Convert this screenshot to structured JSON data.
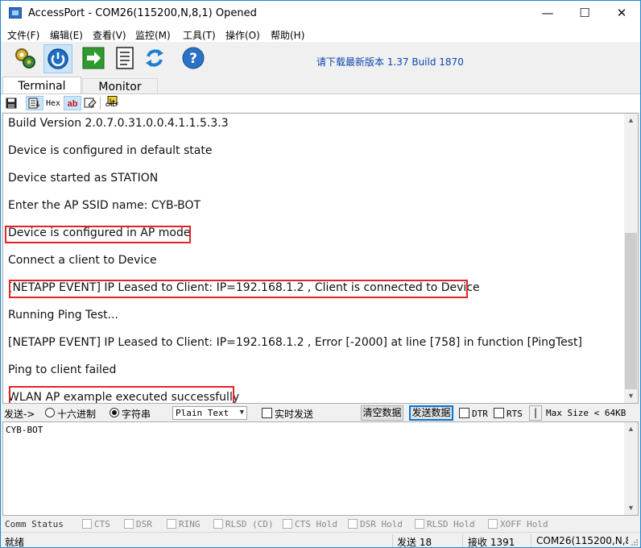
{
  "window": {
    "title": "AccessPort - COM26(115200,N,8,1) Opened",
    "minimize": "—",
    "maximize": "☐",
    "close": "✕"
  },
  "menu": [
    "文件(F)",
    "编辑(E)",
    "查看(V)",
    "监控(M)",
    "工具(T)",
    "操作(O)",
    "帮助(H)"
  ],
  "toolbar": {
    "buttons": [
      "settings-gears",
      "power",
      "go-arrow",
      "document",
      "refresh",
      "help"
    ],
    "promo": "请下载最新版本 1.37 Build 1870"
  },
  "tabs": [
    "Terminal",
    "Monitor"
  ],
  "small_tools": {
    "hex": "Hex",
    "ab": "ab",
    "crlf": "CRLF"
  },
  "terminal": {
    "lines": [
      "Build Version 2.0.7.0.31.0.0.4.1.1.5.3.3",
      "Device is configured in default state",
      "Device started as STATION",
      "Enter the AP SSID name: CYB-BOT",
      "Device is configured in AP mode",
      "Connect a client to Device",
      "[NETAPP EVENT] IP Leased to Client: IP=192.168.1.2 , Client is connected to Device",
      "Running Ping Test...",
      "[NETAPP EVENT] IP Leased to Client: IP=192.168.1.2 , Error [-2000] at line [758] in function [PingTest]",
      "Ping to client failed",
      "WLAN AP example executed successfully"
    ]
  },
  "send_row": {
    "send_label": "发送->",
    "hex_option": "十六进制",
    "string_option": "字符串",
    "selected_format": "Plain Text",
    "realtime_send": "实时发送",
    "clear_button": "清空数据",
    "send_button": "发送数据",
    "dtr": "DTR",
    "rts": "RTS",
    "pipe": "|",
    "max_size": "Max Size < 64KB"
  },
  "send_box": {
    "value": "CYB-BOT"
  },
  "comm_status": {
    "label": "Comm Status",
    "items": [
      "CTS",
      "DSR",
      "RING",
      "RLSD (CD)",
      "CTS Hold",
      "DSR Hold",
      "RLSD Hold",
      "XOFF Hold"
    ]
  },
  "status_bar": {
    "state": "就绪",
    "sent": "发送 18",
    "received": "接收 1391",
    "port": "COM26(115200,N,8"
  },
  "colors": {
    "highlight_box": "#e0242a",
    "window_border": "#1d8ad6",
    "promo_text": "#0b47b0"
  }
}
